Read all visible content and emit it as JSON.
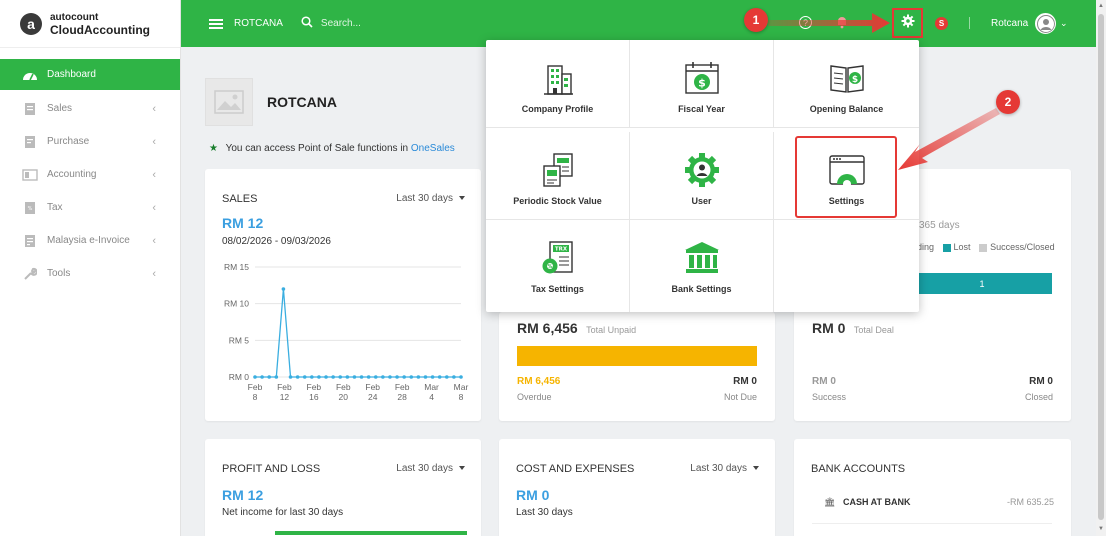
{
  "app": {
    "logo_top": "autocount",
    "logo_bottom": "CloudAccounting",
    "logo_letter": "a"
  },
  "topbar": {
    "company": "ROTCANA",
    "search_placeholder": "Search...",
    "help": "?",
    "s_badge": "S",
    "username": "Rotcana"
  },
  "sidebar": {
    "items": [
      {
        "label": "Dashboard",
        "icon": "dashboard-icon"
      },
      {
        "label": "Sales",
        "icon": "sales-icon"
      },
      {
        "label": "Purchase",
        "icon": "purchase-icon"
      },
      {
        "label": "Accounting",
        "icon": "accounting-icon"
      },
      {
        "label": "Tax",
        "icon": "tax-icon"
      },
      {
        "label": "Malaysia e-Invoice",
        "icon": "einvoice-icon"
      },
      {
        "label": "Tools",
        "icon": "tools-icon"
      }
    ]
  },
  "main": {
    "company_name": "ROTCANA",
    "pos_note": "You can access Point of Sale functions in",
    "pos_link": "OneSales"
  },
  "sales_card": {
    "title": "SALES",
    "period": "Last 30 days",
    "value": "RM 12",
    "range": "08/02/2026 - 09/03/2026"
  },
  "chart_data": {
    "type": "line",
    "x": [
      "Feb 8",
      "Feb 12",
      "Feb 16",
      "Feb 20",
      "Feb 24",
      "Feb 28",
      "Mar 4",
      "Mar 8"
    ],
    "ytick_labels": [
      "RM 0",
      "RM 5",
      "RM 10",
      "RM 15"
    ],
    "ylim": [
      0,
      15
    ],
    "series": [
      {
        "values": [
          0,
          0,
          0,
          0,
          12,
          0,
          0,
          0,
          0,
          0,
          0,
          0,
          0,
          0,
          0,
          0,
          0,
          0,
          0,
          0,
          0,
          0,
          0,
          0,
          0,
          0,
          0,
          0,
          0,
          0
        ]
      }
    ],
    "color": "#3aaee0",
    "grid": true
  },
  "unpaid_card": {
    "value": "RM 6,456",
    "label": "Total Unpaid",
    "overdue_value": "RM 6,456",
    "overdue_label": "Overdue",
    "notdue_value": "RM 0",
    "notdue_label": "Not Due",
    "overdue_fraction": 1.0
  },
  "deal_card": {
    "period_partial": "365 days",
    "legend_pending": "nding",
    "legend_lost": "Lost",
    "legend_success": "Success/Closed",
    "bar_value": "1",
    "value": "RM 0",
    "label": "Total Deal",
    "success_value": "RM 0",
    "success_label": "Success",
    "closed_value": "RM 0",
    "closed_label": "Closed",
    "colors": {
      "lost": "#17a0a5",
      "success": "#cccccc"
    }
  },
  "pl_card": {
    "title": "PROFIT AND LOSS",
    "period": "Last 30 days",
    "value": "RM 12",
    "sub": "Net income for last 30 days"
  },
  "cost_card": {
    "title": "COST AND EXPENSES",
    "period": "Last 30 days",
    "value": "RM 0",
    "sub": "Last 30 days"
  },
  "bank_card": {
    "title": "BANK ACCOUNTS",
    "account": "CASH AT BANK",
    "balance": "-RM 635.25"
  },
  "popup": {
    "tiles": [
      {
        "label": "Company Profile",
        "icon": "company-profile-icon"
      },
      {
        "label": "Fiscal Year",
        "icon": "fiscal-year-icon"
      },
      {
        "label": "Opening Balance",
        "icon": "opening-balance-icon"
      },
      {
        "label": "Periodic Stock Value",
        "icon": "stock-value-icon"
      },
      {
        "label": "User",
        "icon": "user-icon"
      },
      {
        "label": "Settings",
        "icon": "settings-icon"
      },
      {
        "label": "Tax Settings",
        "icon": "tax-settings-icon"
      },
      {
        "label": "Bank Settings",
        "icon": "bank-settings-icon"
      }
    ]
  },
  "annotations": {
    "step1": "1",
    "step2": "2"
  },
  "colors": {
    "brand_green": "#2fb446",
    "accent_red": "#e53935",
    "link_blue": "#2a8ad8",
    "overdue_yellow": "#f6b400"
  }
}
